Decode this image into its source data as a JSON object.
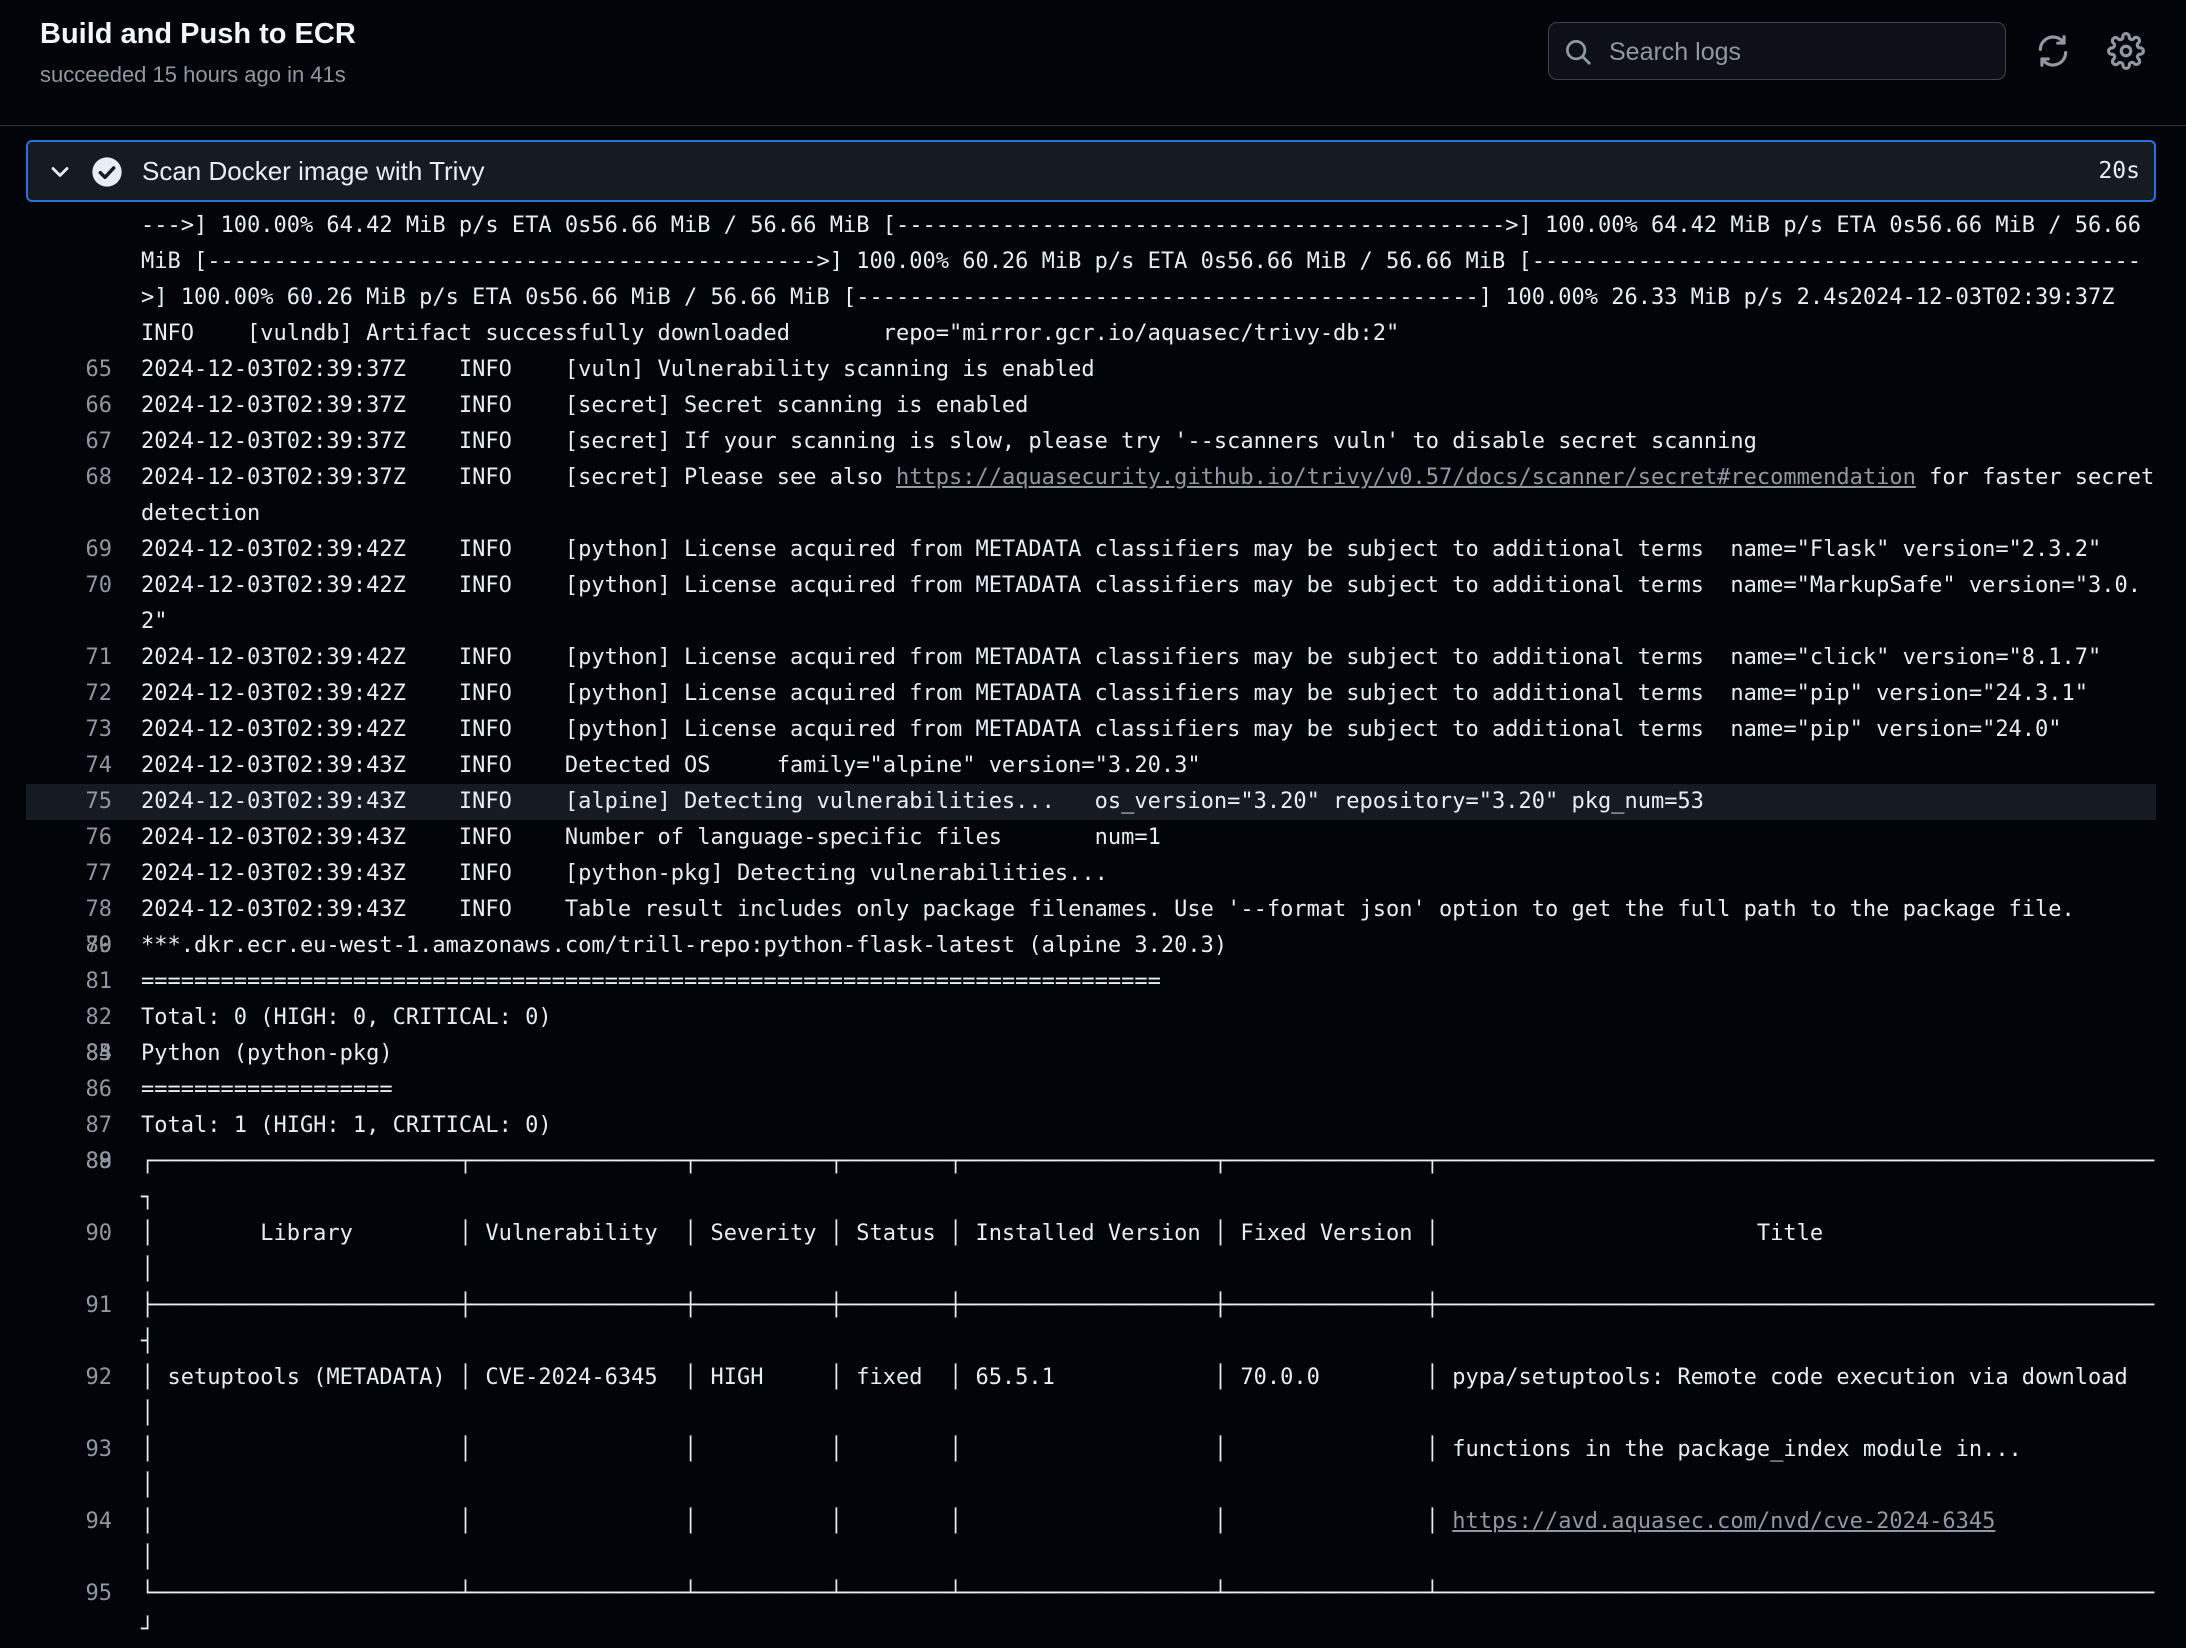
{
  "header": {
    "title": "Build and Push to ECR",
    "subtitle": "succeeded 15 hours ago in 41s",
    "search_placeholder": "Search logs"
  },
  "step": {
    "name": "Scan Docker image with Trivy",
    "duration": "20s"
  },
  "continuation": {
    "text": "--->] 100.00% 64.42 MiB p/s ETA 0s56.66 MiB / 56.66 MiB [---------------------------------------------->] 100.00% 64.42 MiB p/s ETA 0s56.66 MiB / 56.66 MiB [---------------------------------------------->] 100.00% 60.26 MiB p/s ETA 0s56.66 MiB / 56.66 MiB [---------------------------------------------->] 100.00% 60.26 MiB p/s ETA 0s56.66 MiB / 56.66 MiB [-----------------------------------------------] 100.00% 26.33 MiB p/s 2.4s2024-12-03T02:39:37Z    INFO    [vulndb] Artifact successfully downloaded       repo=\"mirror.gcr.io/aquasec/trivy-db:2\""
  },
  "lines": {
    "l65": {
      "num": "65",
      "text": "2024-12-03T02:39:37Z    INFO    [vuln] Vulnerability scanning is enabled"
    },
    "l66": {
      "num": "66",
      "text": "2024-12-03T02:39:37Z    INFO    [secret] Secret scanning is enabled"
    },
    "l67": {
      "num": "67",
      "text": "2024-12-03T02:39:37Z    INFO    [secret] If your scanning is slow, please try '--scanners vuln' to disable secret scanning"
    },
    "l68": {
      "num": "68",
      "pre": "2024-12-03T02:39:37Z    INFO    [secret] Please see also ",
      "link": "https://aquasecurity.github.io/trivy/v0.57/docs/scanner/secret#recommendation",
      "post": " for faster secret detection"
    },
    "l69": {
      "num": "69",
      "text": "2024-12-03T02:39:42Z    INFO    [python] License acquired from METADATA classifiers may be subject to additional terms  name=\"Flask\" version=\"2.3.2\""
    },
    "l70": {
      "num": "70",
      "text": "2024-12-03T02:39:42Z    INFO    [python] License acquired from METADATA classifiers may be subject to additional terms  name=\"MarkupSafe\" version=\"3.0.2\""
    },
    "l71": {
      "num": "71",
      "text": "2024-12-03T02:39:42Z    INFO    [python] License acquired from METADATA classifiers may be subject to additional terms  name=\"click\" version=\"8.1.7\""
    },
    "l72": {
      "num": "72",
      "text": "2024-12-03T02:39:42Z    INFO    [python] License acquired from METADATA classifiers may be subject to additional terms  name=\"pip\" version=\"24.3.1\""
    },
    "l73": {
      "num": "73",
      "text": "2024-12-03T02:39:42Z    INFO    [python] License acquired from METADATA classifiers may be subject to additional terms  name=\"pip\" version=\"24.0\""
    },
    "l74": {
      "num": "74",
      "text": "2024-12-03T02:39:43Z    INFO    Detected OS     family=\"alpine\" version=\"3.20.3\""
    },
    "l75": {
      "num": "75",
      "text": "2024-12-03T02:39:43Z    INFO    [alpine] Detecting vulnerabilities...   os_version=\"3.20\" repository=\"3.20\" pkg_num=53"
    },
    "l76": {
      "num": "76",
      "text": "2024-12-03T02:39:43Z    INFO    Number of language-specific files       num=1"
    },
    "l77": {
      "num": "77",
      "text": "2024-12-03T02:39:43Z    INFO    [python-pkg] Detecting vulnerabilities..."
    },
    "l78": {
      "num": "78",
      "text": "2024-12-03T02:39:43Z    INFO    Table result includes only package filenames. Use '--format json' option to get the full path to the package file."
    },
    "l79": {
      "num": "79",
      "text": ""
    },
    "l80": {
      "num": "80",
      "text": "***.dkr.ecr.eu-west-1.amazonaws.com/trill-repo:python-flask-latest (alpine 3.20.3)"
    },
    "l81": {
      "num": "81",
      "text": "============================================================================="
    },
    "l82": {
      "num": "82",
      "text": "Total: 0 (HIGH: 0, CRITICAL: 0)"
    },
    "l83": {
      "num": "83",
      "text": ""
    },
    "l84": {
      "num": "84",
      "text": ""
    },
    "l85": {
      "num": "85",
      "text": "Python (python-pkg)"
    },
    "l86": {
      "num": "86",
      "text": "==================="
    },
    "l87": {
      "num": "87",
      "text": "Total: 1 (HIGH: 1, CRITICAL: 0)"
    },
    "l88": {
      "num": "88",
      "text": ""
    },
    "l89": {
      "num": "89",
      "text": "┌───────────────────────┬────────────────┬──────────┬────────┬───────────────────┬───────────────┬──────────────────────────────────────────────────────┐"
    },
    "l90": {
      "num": "90",
      "text": "│        Library        │ Vulnerability  │ Severity │ Status │ Installed Version │ Fixed Version │                        Title                         │"
    },
    "l91": {
      "num": "91",
      "text": "├───────────────────────┼────────────────┼──────────┼────────┼───────────────────┼───────────────┼──────────────────────────────────────────────────────┤"
    },
    "l92": {
      "num": "92",
      "text": "│ setuptools (METADATA) │ CVE-2024-6345  │ HIGH     │ fixed  │ 65.5.1            │ 70.0.0        │ pypa/setuptools: Remote code execution via download  │"
    },
    "l93": {
      "num": "93",
      "text": "│                       │                │          │        │                   │               │ functions in the package_index module in...          │"
    },
    "l94": {
      "num": "94",
      "pre": "│                       │                │          │        │                   │               │ ",
      "link": "https://avd.aquasec.com/nvd/cve-2024-6345",
      "post": "             │"
    },
    "l95": {
      "num": "95",
      "text": "└───────────────────────┴────────────────┴──────────┴────────┴───────────────────┴───────────────┴──────────────────────────────────────────────────────┘"
    }
  }
}
